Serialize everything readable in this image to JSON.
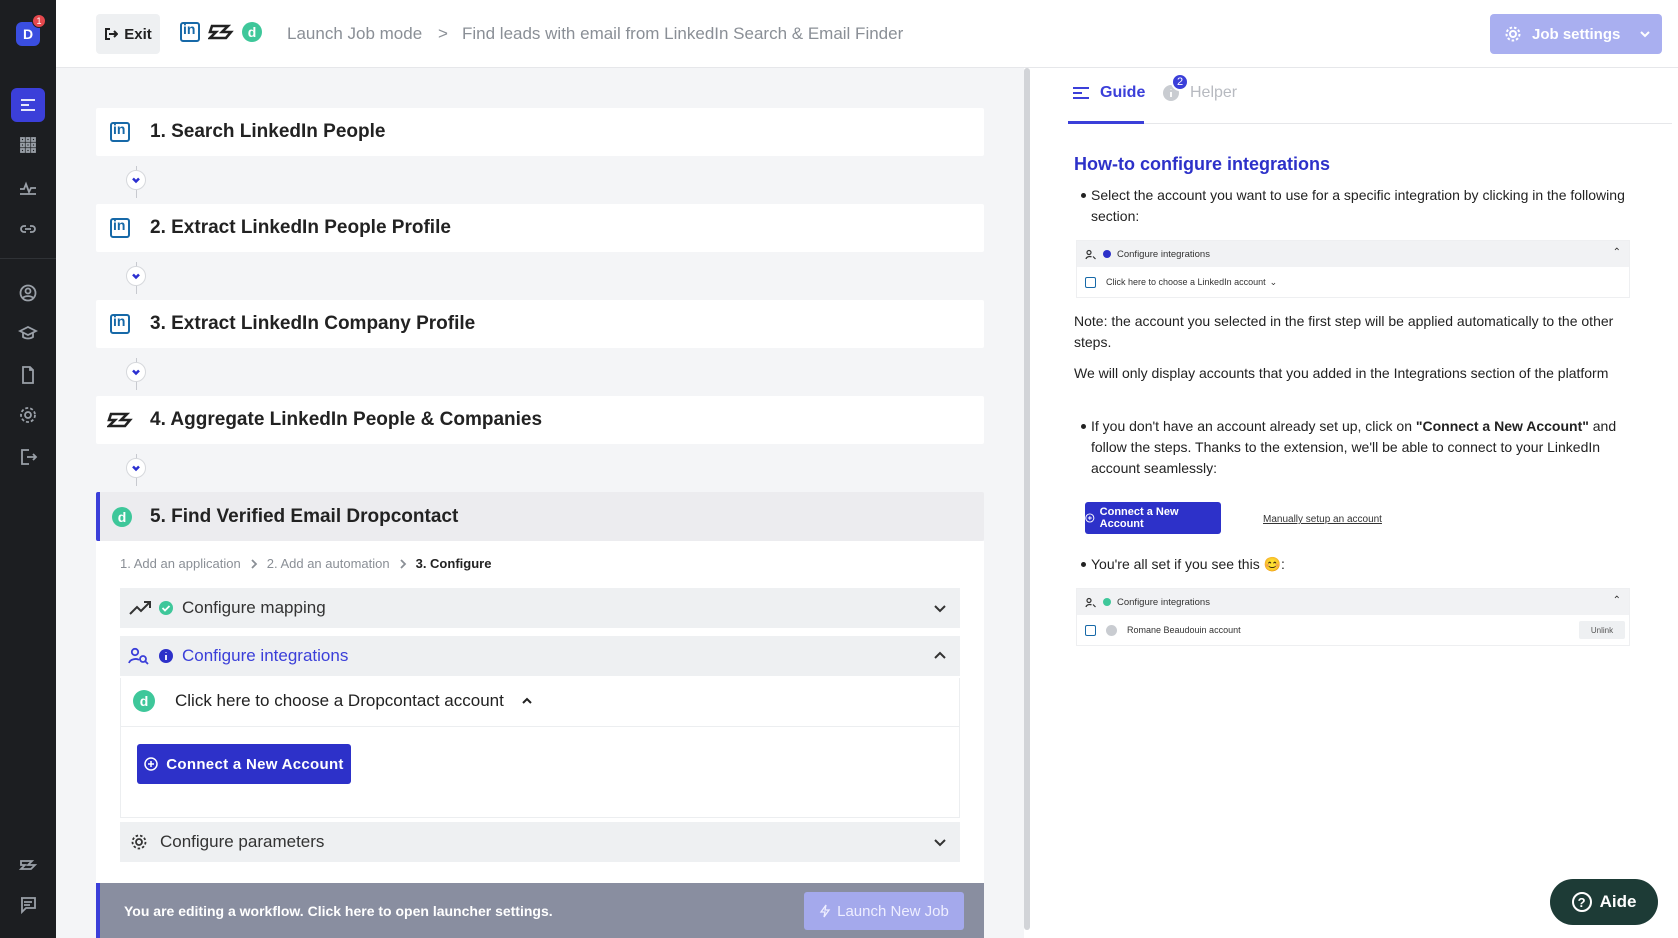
{
  "sidebar": {
    "avatar_letter": "D",
    "avatar_badge": "1",
    "items": [
      {
        "name": "workflows-icon",
        "active": true
      },
      {
        "name": "apps-grid-icon"
      },
      {
        "name": "activity-icon"
      },
      {
        "name": "link-icon"
      },
      {
        "name": "user-circle-icon"
      },
      {
        "name": "graduation-cap-icon"
      },
      {
        "name": "document-icon"
      },
      {
        "name": "gear-icon"
      },
      {
        "name": "logout-icon"
      },
      {
        "name": "brand-logo-icon"
      },
      {
        "name": "chat-icon"
      }
    ]
  },
  "topbar": {
    "exit_label": "Exit",
    "breadcrumb_mode": "Launch Job mode",
    "breadcrumb_separator": ">",
    "breadcrumb_title": "Find leads with email from LinkedIn Search & Email Finder",
    "job_settings_label": "Job settings"
  },
  "steps": [
    {
      "title": "1. Search LinkedIn People",
      "logo": "linkedin-logo-icon"
    },
    {
      "title": "2. Extract LinkedIn People Profile",
      "logo": "linkedin-logo-icon"
    },
    {
      "title": "3. Extract LinkedIn Company Profile",
      "logo": "linkedin-logo-icon"
    },
    {
      "title": "4. Aggregate LinkedIn People & Companies",
      "logo": "aggregate-logo-icon"
    },
    {
      "title": "5. Find Verified Email Dropcontact",
      "logo": "dropcontact-logo-icon"
    }
  ],
  "config": {
    "substeps": [
      "1. Add an application",
      "2. Add an automation",
      "3. Configure"
    ],
    "mapping_label": "Configure mapping",
    "integrations_label": "Configure integrations",
    "choose_account_label": "Click here to choose a Dropcontact account",
    "connect_button_label": "Connect a New Account",
    "parameters_label": "Configure parameters"
  },
  "bottom_bar": {
    "message": "You are editing a workflow. Click here to open launcher settings.",
    "launch_label": "Launch New Job"
  },
  "right_panel": {
    "tabs": {
      "guide": "Guide",
      "helper": "Helper",
      "helper_badge": "2"
    },
    "heading": "How-to configure integrations",
    "p1": "Select the account you want to use for a specific integration by clicking in the following section:",
    "mini1_head": "Configure integrations",
    "mini1_row": "Click here to choose a LinkedIn account",
    "note": "Note: the account you selected in the first step will be applied automatically to the other steps.",
    "p2": "We will only display accounts that you added in the Integrations section of the platform",
    "p3_a": "If you don't have an account already set up, click on ",
    "p3_b": "\"Connect a New Account\"",
    "p3_c": " and follow the steps. Thanks to the extension, we'll be able to connect to your LinkedIn account seamlessly:",
    "mini_connect": "Connect a New Account",
    "mini_manual": "Manually setup an account",
    "p4": "You're all set if you see this 😊:",
    "mini2_head": "Configure integrations",
    "mini2_row": "Romane Beaudouin account",
    "mini2_unlink": "Unlink"
  },
  "aide_label": "Aide",
  "colors": {
    "accent": "#3b3fd9",
    "sidebar": "#1c1e21",
    "success": "#3ec79a"
  }
}
